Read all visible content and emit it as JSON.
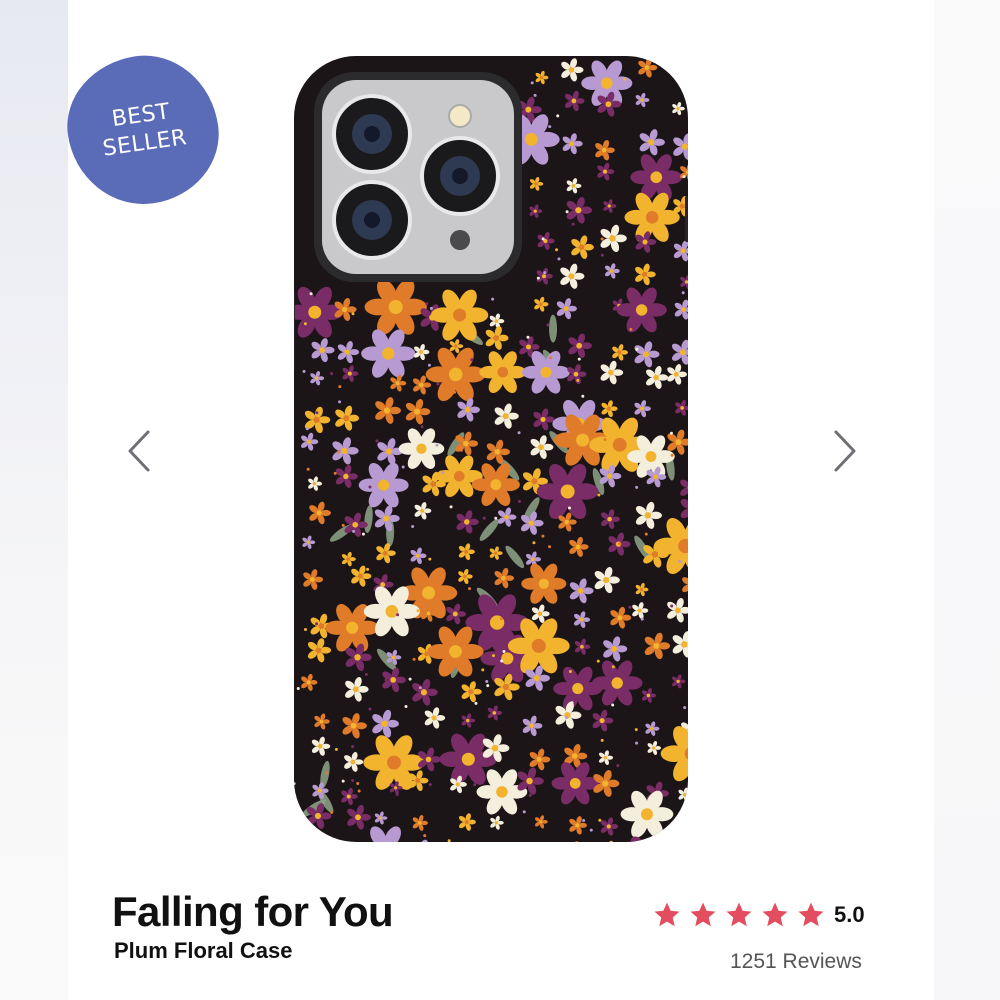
{
  "badge": {
    "line1": "BEST",
    "line2": "SELLER"
  },
  "product": {
    "title": "Falling for You",
    "subtitle": "Plum Floral Case"
  },
  "rating": {
    "stars": 5,
    "value": "5.0",
    "reviews": "1251 Reviews"
  },
  "icons": {
    "prev": "chevron-left-icon",
    "next": "chevron-right-icon",
    "star": "star-icon"
  },
  "colors": {
    "badge": "#5a6cb8",
    "star": "#e24e5f",
    "case_background": "#1c1518",
    "flower_plum": "#7a2c66",
    "flower_yellow": "#f2b32e",
    "flower_lavender": "#b79ad2",
    "flower_cream": "#f4eedc",
    "flower_orange": "#e07b2a"
  }
}
